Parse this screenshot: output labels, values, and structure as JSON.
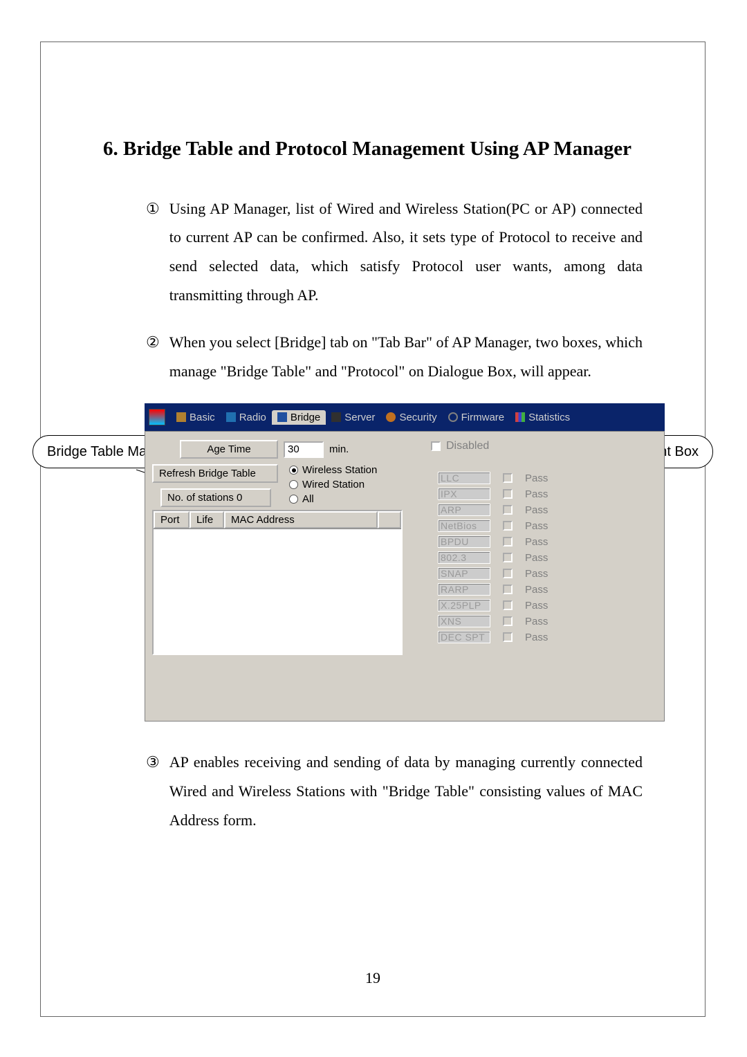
{
  "section": {
    "number": "6.",
    "title": "Bridge Table and Protocol Management Using AP Manager"
  },
  "items": [
    {
      "num": "①",
      "text": "Using AP Manager, list of Wired and Wireless Station(PC or AP) connected to current AP can be confirmed. Also, it sets type of Protocol to receive and send selected data, which satisfy Protocol user wants, among data transmitting through AP."
    },
    {
      "num": "②",
      "text": "When you select [Bridge] tab on \"Tab Bar\" of AP Manager, two boxes, which manage \"Bridge Table\" and \"Protocol\" on Dialogue Box, will appear."
    },
    {
      "num": "③",
      "text": "AP enables receiving and sending of data by managing currently connected Wired and Wireless Stations with \"Bridge Table\" consisting values of MAC Address form."
    }
  ],
  "tabs": {
    "basic": "Basic",
    "radio": "Radio",
    "bridge": "Bridge",
    "server": "Server",
    "security": "Security",
    "firmware": "Firmware",
    "statistics": "Statistics"
  },
  "bridgeTable": {
    "age_time_btn": "Age Time",
    "age_time_value": "30",
    "age_time_unit": "min.",
    "refresh_btn": "Refresh Bridge Table",
    "stations_btn": "No. of stations 0",
    "radio_wireless": "Wireless Station",
    "radio_wired": "Wired Station",
    "radio_all": "All",
    "th_port": "Port",
    "th_life": "Life",
    "th_mac": "MAC Address"
  },
  "protocol": {
    "disabled_label": "Disabled",
    "pass_label": "Pass",
    "rows": [
      "LLC",
      "IPX",
      "ARP",
      "NetBios",
      "BPDU",
      "802.3",
      "SNAP",
      "RARP",
      "X.25PLP",
      "XNS",
      "DEC SPT"
    ]
  },
  "callouts": {
    "left": "Bridge Table Management Box",
    "right": "Protocol Management Box"
  },
  "pageNumber": "19"
}
